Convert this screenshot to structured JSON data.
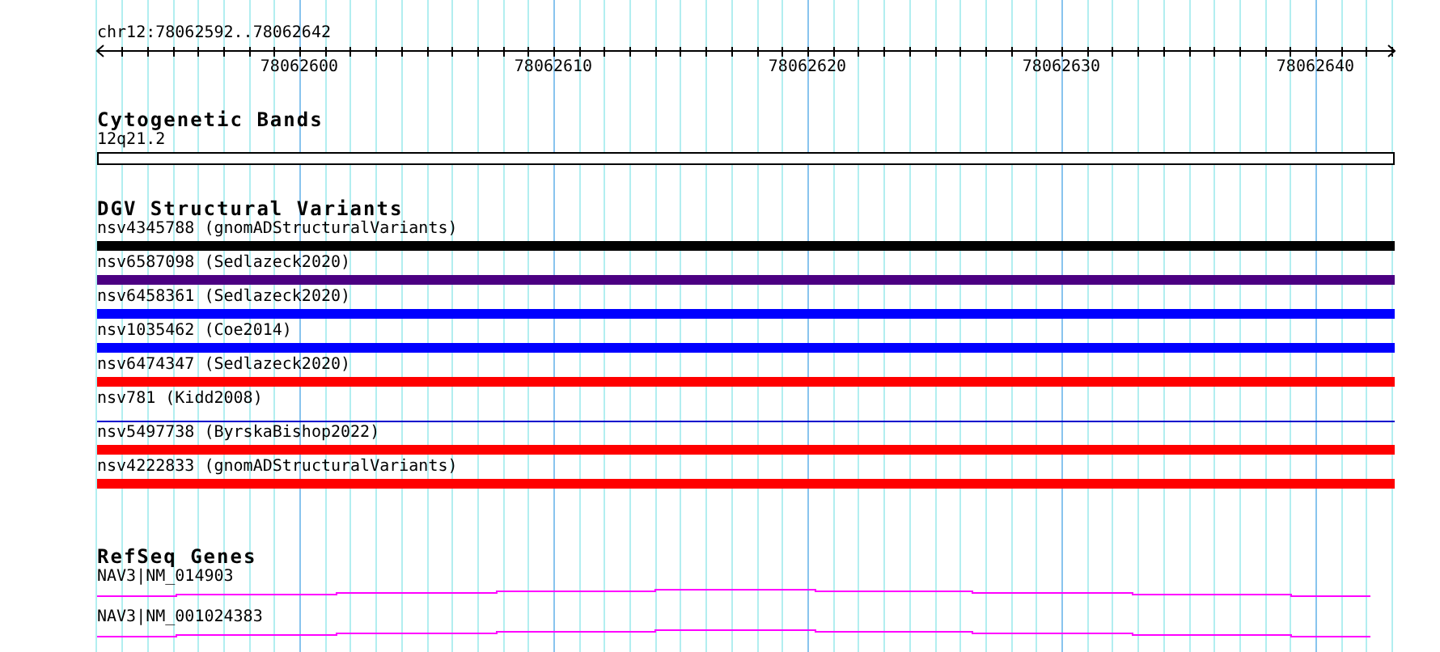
{
  "ruler": {
    "location": "chr12:78062592..78062642",
    "tick_labels": [
      "78062600",
      "78062610",
      "78062620",
      "78062630",
      "78062640"
    ]
  },
  "tracks": [
    {
      "kind": "bands",
      "title": "Cytogenetic Bands",
      "features": [
        {
          "label": "12q21.2"
        }
      ]
    },
    {
      "kind": "variants",
      "title": "DGV Structural Variants",
      "features": [
        {
          "label": "nsv4345788 (gnomADStructuralVariants)",
          "kind": "bar",
          "color": "#000000"
        },
        {
          "label": "nsv6587098 (Sedlazeck2020)",
          "kind": "bar",
          "color": "#4b0082"
        },
        {
          "label": "nsv6458361 (Sedlazeck2020)",
          "kind": "bar",
          "color": "#0000ff"
        },
        {
          "label": "nsv1035462 (Coe2014)",
          "kind": "bar",
          "color": "#0000ff"
        },
        {
          "label": "nsv6474347 (Sedlazeck2020)",
          "kind": "bar",
          "color": "#ff0000"
        },
        {
          "label": "nsv781 (Kidd2008)",
          "kind": "line",
          "color": "#0000cc"
        },
        {
          "label": "nsv5497738 (ByrskaBishop2022)",
          "kind": "bar",
          "color": "#ff0000"
        },
        {
          "label": "nsv4222833 (gnomADStructuralVariants)",
          "kind": "bar",
          "color": "#ff0000"
        }
      ]
    },
    {
      "kind": "genes",
      "title": "RefSeq Genes",
      "features": [
        {
          "label": "NAV3|NM_014903"
        },
        {
          "label": "NAV3|NM_001024383"
        }
      ]
    }
  ]
}
